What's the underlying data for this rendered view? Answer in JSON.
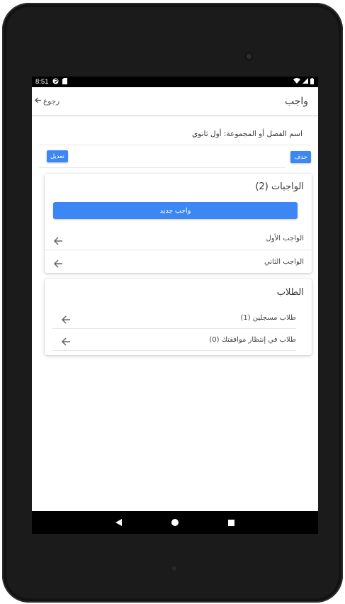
{
  "status_bar": {
    "time": "8:51",
    "icons": [
      "app-notification-icon",
      "sd-card-icon",
      "wifi-icon",
      "cell-signal-icon",
      "battery-icon"
    ]
  },
  "app_bar": {
    "title": "واجب",
    "back_label": "رجوع"
  },
  "class_info": {
    "label": "اسم الفصل أو المجموعة: أول ثانوي"
  },
  "actions": {
    "delete_label": "حذف",
    "edit_label": "تعديل"
  },
  "homework_card": {
    "title": "الواجبات (2)",
    "new_button_label": "واجب جديد",
    "items": [
      {
        "label": "الواجب الأول"
      },
      {
        "label": "الواجب الثاني"
      }
    ]
  },
  "students_card": {
    "title": "الطلاب",
    "items": [
      {
        "label": "طلاب مسجلين (1)"
      },
      {
        "label": "طلاب في إنتظار موافقتك (0)"
      }
    ]
  },
  "colors": {
    "accent": "#3d87f5",
    "device_frame": "#1b1b1b"
  }
}
